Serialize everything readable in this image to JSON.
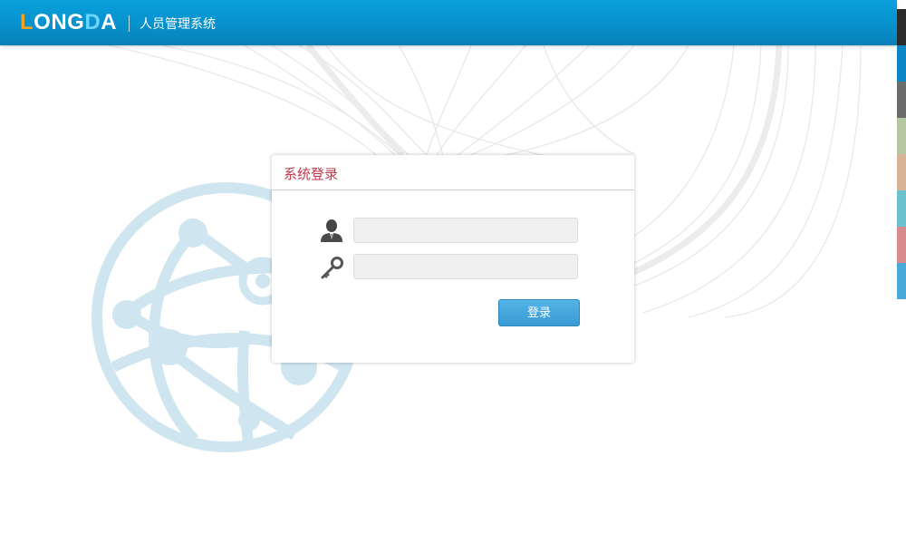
{
  "header": {
    "logo": {
      "part1": "L",
      "part2": "ONG",
      "part3": "D",
      "part4": "A",
      "colors": {
        "l": "#f7a21c",
        "ong": "#ffffff",
        "d": "#6fd3ff",
        "a": "#ffffff"
      }
    },
    "app_title": "人员管理系统",
    "background": "#0791cd"
  },
  "login": {
    "title": "系统登录",
    "title_color": "#c0384a",
    "username": {
      "icon": "user-icon",
      "value": "",
      "placeholder": ""
    },
    "password": {
      "icon": "key-icon",
      "value": "",
      "placeholder": ""
    },
    "submit_label": "登录"
  },
  "theme_swatches": [
    {
      "name": "dark",
      "color": "#2b2b2b"
    },
    {
      "name": "blue",
      "color": "#0a86c4"
    },
    {
      "name": "gray",
      "color": "#6b6b6b"
    },
    {
      "name": "olive",
      "color": "#b4c7a1"
    },
    {
      "name": "tan",
      "color": "#d9b395"
    },
    {
      "name": "teal",
      "color": "#6cc1cf"
    },
    {
      "name": "rose",
      "color": "#d98a8c"
    },
    {
      "name": "sky",
      "color": "#49aad9"
    }
  ],
  "background": {
    "decoration": "globe-network-graphic",
    "globe_color": "#cfe5ef",
    "line_color": "#e6e6e6"
  }
}
